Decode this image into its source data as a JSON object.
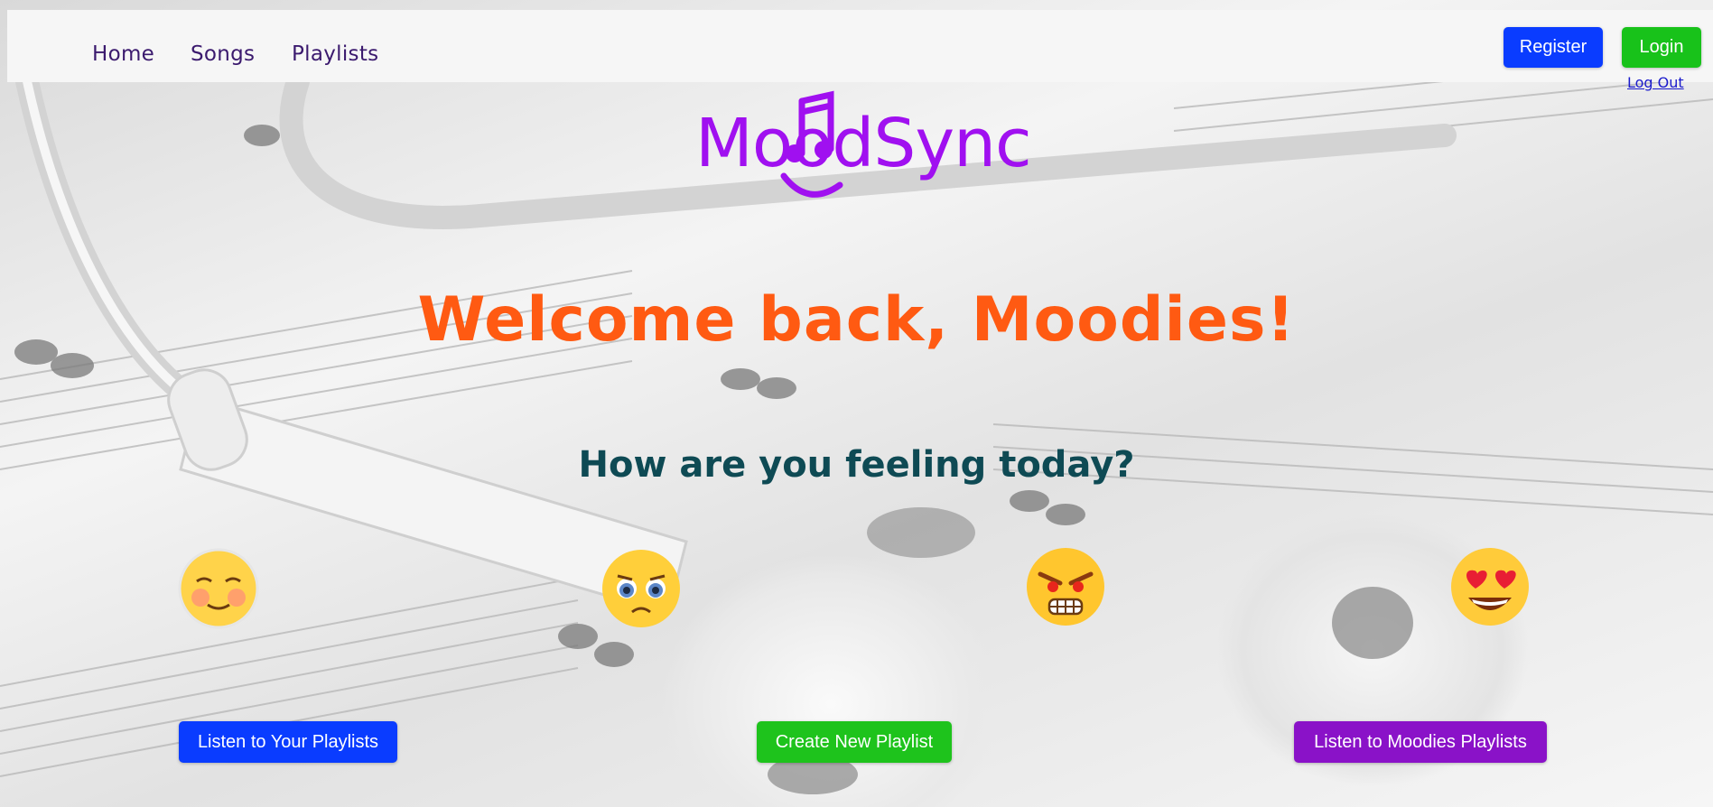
{
  "nav": {
    "items": [
      {
        "label": "Home"
      },
      {
        "label": "Songs"
      },
      {
        "label": "Playlists"
      }
    ],
    "register_label": "Register",
    "login_label": "Login",
    "logout_label": "Log Out"
  },
  "logo": {
    "text": "MoodSync"
  },
  "hero": {
    "welcome": "Welcome back, Moodies!",
    "question": "How are you feeling today?"
  },
  "moods": [
    {
      "icon": "blushing-face-icon"
    },
    {
      "icon": "pleading-face-icon"
    },
    {
      "icon": "angry-face-icon"
    },
    {
      "icon": "heart-eyes-face-icon"
    }
  ],
  "actions": {
    "your_playlists": "Listen to Your Playlists",
    "create_playlist": "Create New Playlist",
    "moodies_playlists": "Listen to Moodies Playlists"
  },
  "colors": {
    "register": "#0a3cff",
    "login": "#18c21a",
    "create": "#1ec31c",
    "moodies": "#8a12c8",
    "welcome": "#ff5a12",
    "logo": "#a010f0"
  }
}
